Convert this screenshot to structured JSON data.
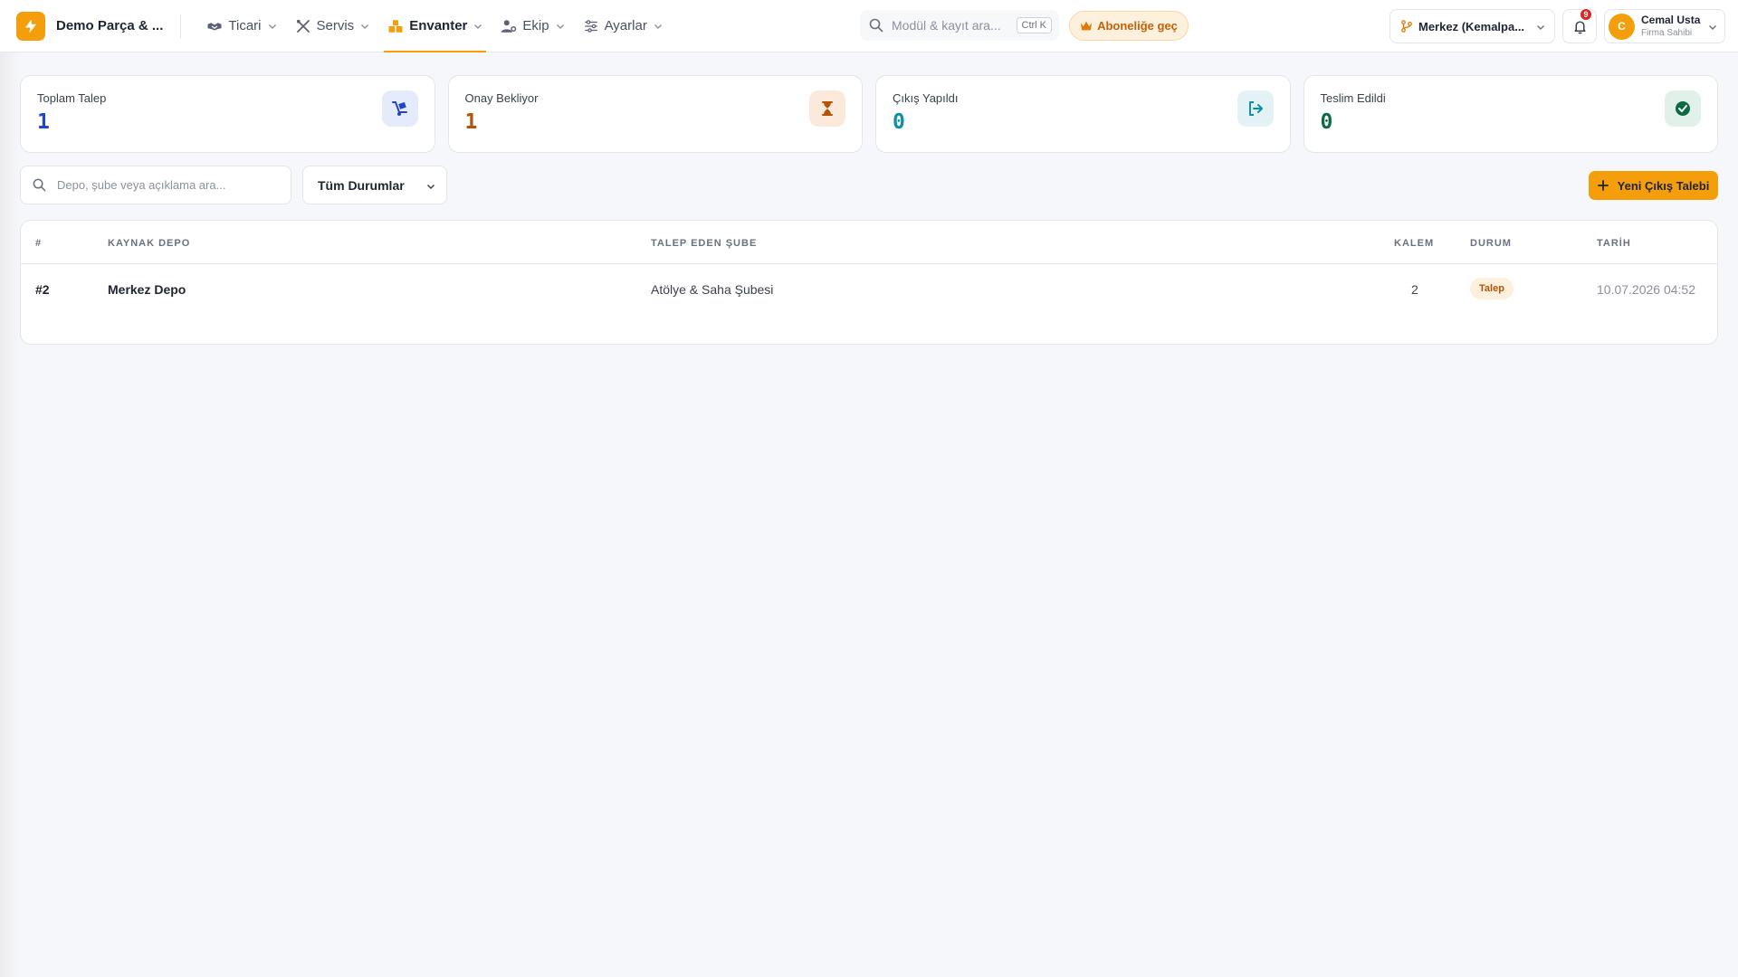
{
  "brand": {
    "name": "Demo Parça & ..."
  },
  "nav": {
    "items": [
      {
        "label": "Ticari",
        "icon": "handshake-icon"
      },
      {
        "label": "Servis",
        "icon": "tools-icon"
      },
      {
        "label": "Envanter",
        "icon": "boxes-icon",
        "active": true
      },
      {
        "label": "Ekip",
        "icon": "users-gear-icon"
      },
      {
        "label": "Ayarlar",
        "icon": "sliders-icon"
      }
    ]
  },
  "search": {
    "placeholder": "Modül & kayıt ara...",
    "shortcut": "Ctrl K"
  },
  "upgrade": {
    "label": "Aboneliğe geç"
  },
  "branch": {
    "label": "Merkez (Kemalpa..."
  },
  "notifications": {
    "count": "9"
  },
  "user": {
    "initial": "C",
    "name": "Cemal Usta",
    "role": "Firma Sahibi"
  },
  "stats": [
    {
      "label": "Toplam Talep",
      "value": "1",
      "color": "#2346c7",
      "icon": "dolly-icon",
      "icon_bg": "#e6ebfb"
    },
    {
      "label": "Onay Bekliyor",
      "value": "1",
      "color": "#b45309",
      "icon": "hourglass-icon",
      "icon_bg": "#fbe9dc"
    },
    {
      "label": "Çıkış Yapıldı",
      "value": "0",
      "color": "#0e8fa8",
      "icon": "exit-icon",
      "icon_bg": "#e2f2f5"
    },
    {
      "label": "Teslim Edildi",
      "value": "0",
      "color": "#0b6b45",
      "icon": "check-circle-icon",
      "icon_bg": "#e1f1ea"
    }
  ],
  "filters": {
    "search_placeholder": "Depo, şube veya açıklama ara...",
    "status_selected": "Tüm Durumlar",
    "new_button": "Yeni Çıkış Talebi"
  },
  "table": {
    "columns": [
      "#",
      "KAYNAK DEPO",
      "TALEP EDEN ŞUBE",
      "KALEM",
      "DURUM",
      "TARİH"
    ],
    "rows": [
      {
        "id": "#2",
        "source": "Merkez Depo",
        "branch": "Atölye & Saha Şubesi",
        "items": "2",
        "status": "Talep",
        "date": "10.07.2026 04:52"
      }
    ]
  },
  "colors": {
    "accent": "#f59e0b"
  }
}
